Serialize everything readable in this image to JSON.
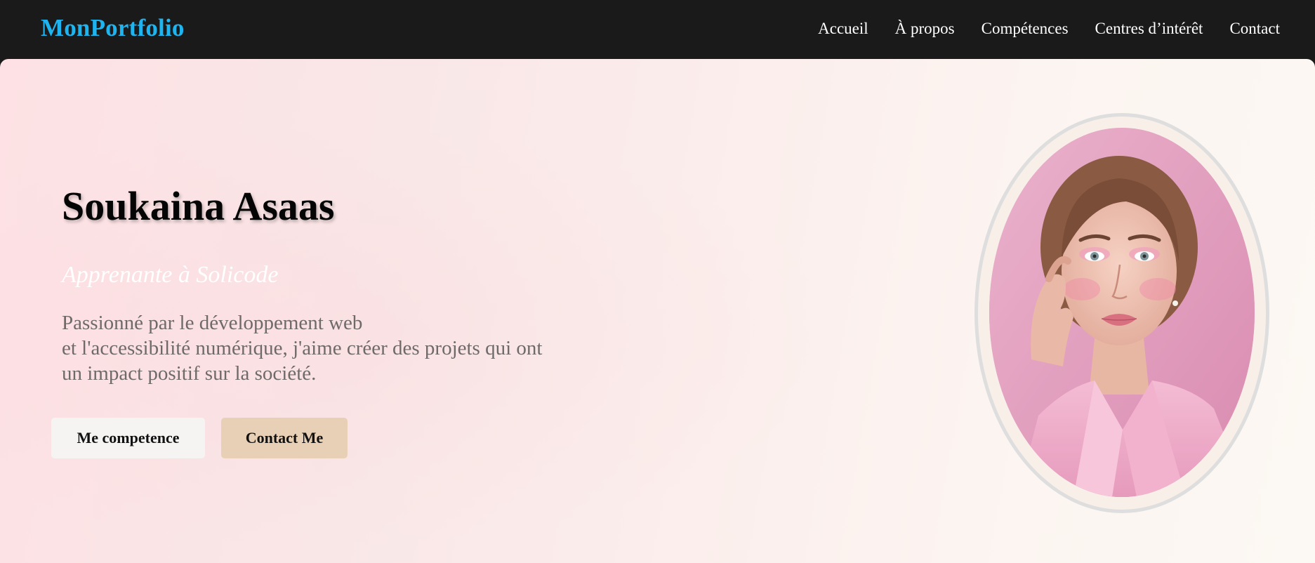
{
  "nav": {
    "brand": "MonPortfolio",
    "links": [
      {
        "label": "Accueil"
      },
      {
        "label": "À propos"
      },
      {
        "label": "Compétences"
      },
      {
        "label": "Centres d’intérêt"
      },
      {
        "label": "Contact"
      }
    ]
  },
  "hero": {
    "name": "Soukaina Asaas",
    "subtitle": "Apprenante à Solicode",
    "description_lines": [
      "Passionné par le développement web",
      "et l'accessibilité numérique, j'aime créer des projets qui ont",
      "un impact positif sur la société."
    ],
    "buttons": {
      "skills": "Me competence",
      "contact": "Contact Me"
    }
  },
  "colors": {
    "brand": "#1eb4f0",
    "navbar_bg": "#1a1a1a",
    "skills_button_bg": "#f6f3f3",
    "contact_button_bg": "#e8d0b7",
    "portrait_bg": "#e7a9c4"
  },
  "portrait": {
    "icon": "profile-photo"
  }
}
